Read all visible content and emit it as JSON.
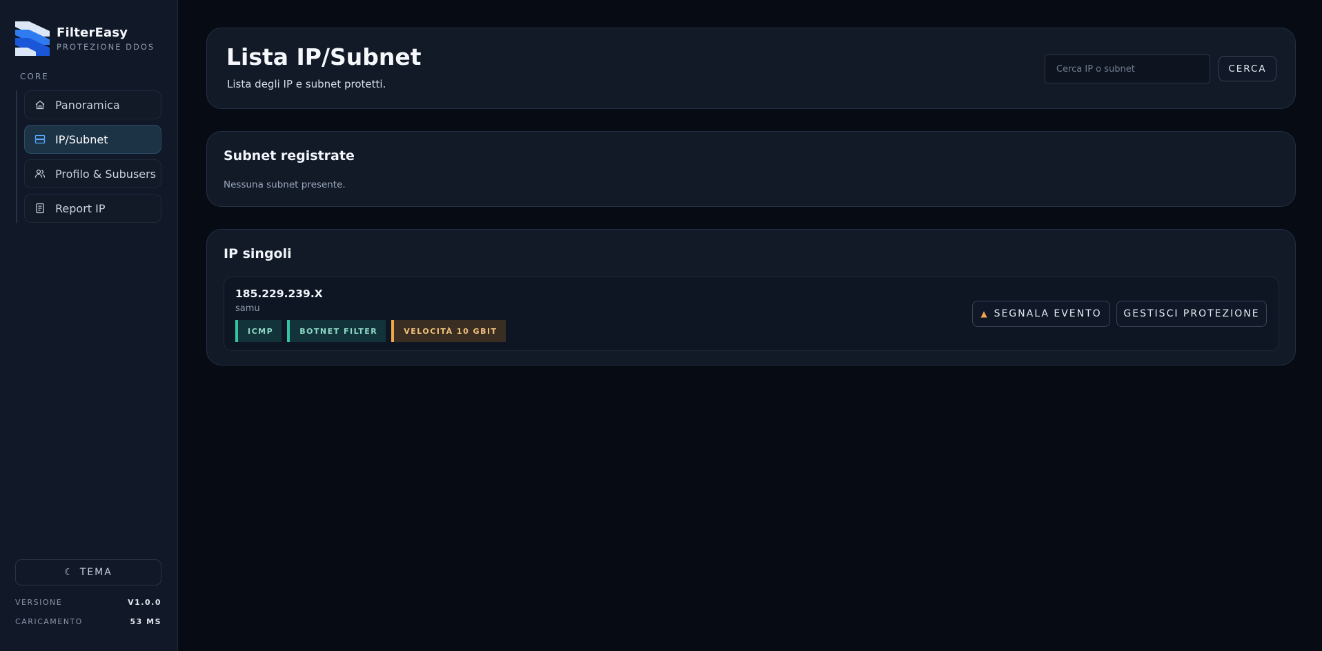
{
  "brand": {
    "name": "FilterEasy",
    "subtitle": "PROTEZIONE DDOS"
  },
  "sidebar": {
    "section_label": "CORE",
    "items": [
      {
        "label": "Panoramica",
        "icon": "home-icon",
        "active": false
      },
      {
        "label": "IP/Subnet",
        "icon": "server-icon",
        "active": true
      },
      {
        "label": "Profilo & Subusers",
        "icon": "users-icon",
        "active": false
      },
      {
        "label": "Report IP",
        "icon": "document-icon",
        "active": false
      }
    ],
    "theme_label": "TEMA",
    "version_key": "VERSIONE",
    "version_value": "V1.0.0",
    "load_key": "CARICAMENTO",
    "load_value": "53 MS"
  },
  "header": {
    "title": "Lista IP/Subnet",
    "subtitle": "Lista degli IP e subnet protetti.",
    "search_placeholder": "Cerca IP o subnet",
    "search_button": "CERCA"
  },
  "subnets": {
    "title": "Subnet registrate",
    "empty_text": "Nessuna subnet presente."
  },
  "ips": {
    "title": "IP singoli",
    "items": [
      {
        "address": "185.229.239.X",
        "owner": "samu",
        "tags": [
          {
            "label": "ICMP",
            "kind": "ok"
          },
          {
            "label": "BOTNET FILTER",
            "kind": "ok"
          },
          {
            "label": "VELOCITÀ 10 GBIT",
            "kind": "warn"
          }
        ],
        "report_button": "SEGNALA EVENTO",
        "manage_button": "GESTISCI PROTEZIONE"
      }
    ]
  },
  "colors": {
    "accent": "#3b82f6",
    "tag_ok": "#34c4a3",
    "tag_warn": "#f0a64a",
    "background": "#070b14",
    "card": "#121a28"
  }
}
